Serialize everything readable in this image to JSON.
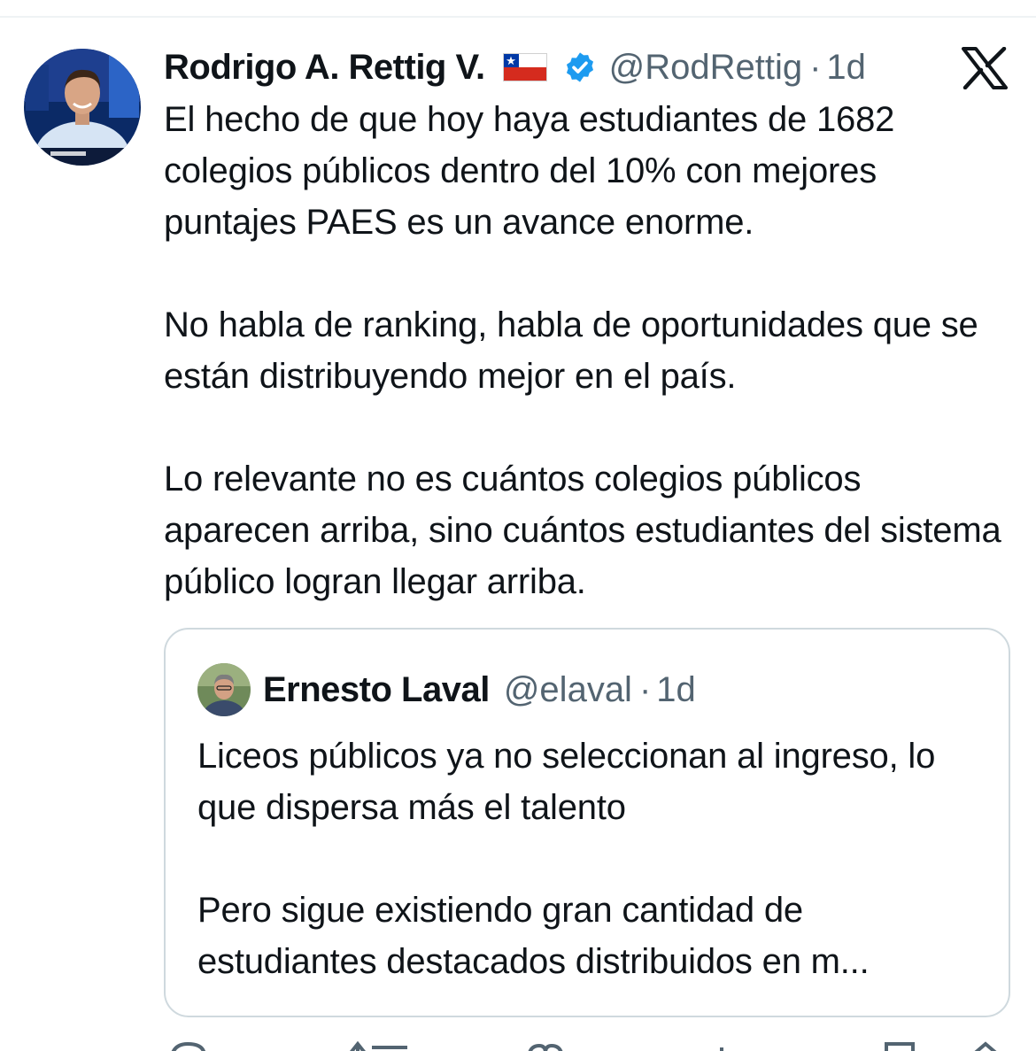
{
  "tweet": {
    "author_name": "Rodrigo A. Rettig V.",
    "flag_icon": "chile-flag-icon",
    "verified_icon": "verified-badge-icon",
    "handle": "@RodRettig",
    "separator": "·",
    "time": "1d",
    "platform_icon": "x-logo-icon",
    "paragraphs": [
      "El hecho de que hoy haya estudiantes de 1682 colegios públicos dentro del 10% con mejores puntajes PAES es un avance enorme.",
      "No habla de ranking, habla de oportunidades que se están distribuyendo mejor en el país.",
      "Lo relevante no es cuántos colegios públicos aparecen arriba, sino cuántos estudiantes del sistema público logran llegar arriba."
    ]
  },
  "quoted_tweet": {
    "author_name": "Ernesto Laval",
    "handle": "@elaval",
    "separator": "·",
    "time": "1d",
    "paragraphs": [
      "Liceos públicos ya no seleccionan al ingreso, lo que dispersa más el talento",
      "Pero sigue existiendo gran cantidad de estudiantes destacados distribuidos en m..."
    ]
  },
  "actions": [
    "reply-icon",
    "retweet-icon",
    "like-icon",
    "views-icon",
    "bookmark-icon",
    "share-icon"
  ],
  "colors": {
    "text": "#0f1419",
    "secondary": "#536471",
    "verified": "#1d9bf0",
    "border": "#cfd9de"
  }
}
